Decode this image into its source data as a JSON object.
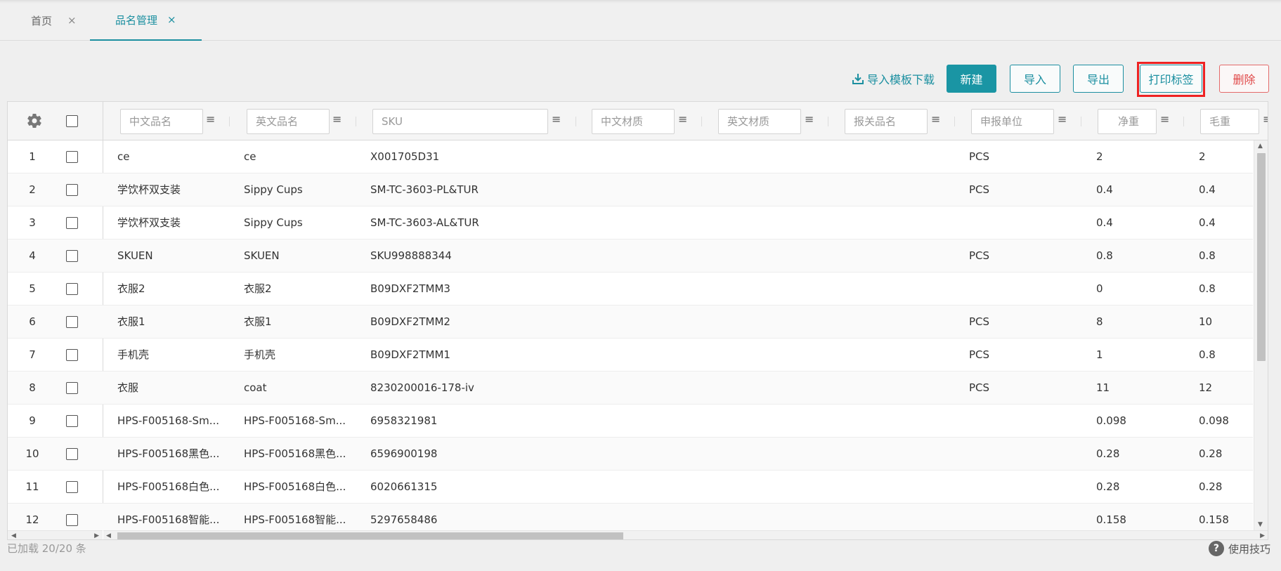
{
  "tabs": [
    {
      "label": "首页",
      "close": "×"
    },
    {
      "label": "品名管理",
      "close": "×"
    }
  ],
  "toolbar": {
    "template_download": "导入模板下载",
    "new": "新建",
    "import": "导入",
    "export": "导出",
    "print_label": "打印标签",
    "delete": "删除"
  },
  "filters": {
    "cn_name": "中文品名",
    "en_name": "英文品名",
    "sku": "SKU",
    "cn_material": "中文材质",
    "en_material": "英文材质",
    "customs_name": "报关品名",
    "unit": "申报单位",
    "net_weight": "净重",
    "gross_weight": "毛重"
  },
  "rows": [
    {
      "idx": "1",
      "cn": "ce",
      "en": "ce",
      "sku": "X001705D31",
      "unit": "PCS",
      "net": "2",
      "gross": "2"
    },
    {
      "idx": "2",
      "cn": "学饮杯双支装",
      "en": "Sippy Cups",
      "sku": "SM-TC-3603-PL&TUR",
      "unit": "PCS",
      "net": "0.4",
      "gross": "0.4"
    },
    {
      "idx": "3",
      "cn": "学饮杯双支装",
      "en": "Sippy Cups",
      "sku": "SM-TC-3603-AL&TUR",
      "unit": "",
      "net": "0.4",
      "gross": "0.4"
    },
    {
      "idx": "4",
      "cn": "SKUEN",
      "en": "SKUEN",
      "sku": "SKU998888344",
      "unit": "PCS",
      "net": "0.8",
      "gross": "0.8"
    },
    {
      "idx": "5",
      "cn": "衣服2",
      "en": "衣服2",
      "sku": "B09DXF2TMM3",
      "unit": "",
      "net": "0",
      "gross": "0.8"
    },
    {
      "idx": "6",
      "cn": "衣服1",
      "en": "衣服1",
      "sku": "B09DXF2TMM2",
      "unit": "PCS",
      "net": "8",
      "gross": "10"
    },
    {
      "idx": "7",
      "cn": "手机壳",
      "en": "手机壳",
      "sku": "B09DXF2TMM1",
      "unit": "PCS",
      "net": "1",
      "gross": "0.8"
    },
    {
      "idx": "8",
      "cn": "衣服",
      "en": "coat",
      "sku": "8230200016-178-iv",
      "unit": "PCS",
      "net": "11",
      "gross": "12"
    },
    {
      "idx": "9",
      "cn": "HPS-F005168-Sm...",
      "en": "HPS-F005168-Sm...",
      "sku": "6958321981",
      "unit": "",
      "net": "0.098",
      "gross": "0.098"
    },
    {
      "idx": "10",
      "cn": "HPS-F005168黑色...",
      "en": "HPS-F005168黑色...",
      "sku": "6596900198",
      "unit": "",
      "net": "0.28",
      "gross": "0.28"
    },
    {
      "idx": "11",
      "cn": "HPS-F005168白色...",
      "en": "HPS-F005168白色...",
      "sku": "6020661315",
      "unit": "",
      "net": "0.28",
      "gross": "0.28"
    },
    {
      "idx": "12",
      "cn": "HPS-F005168智能...",
      "en": "HPS-F005168智能...",
      "sku": "5297658486",
      "unit": "",
      "net": "0.158",
      "gross": "0.158"
    }
  ],
  "footer": {
    "status": "已加载 20/20 条",
    "tips": "使用技巧",
    "tips_icon": "?"
  },
  "icons": {
    "settings": "gear-icon",
    "download": "download-icon",
    "menu": "≡",
    "up": "▲",
    "down": "▼",
    "left": "◀",
    "right": "▶"
  },
  "colors": {
    "accent": "#1b8fa0",
    "primary_button": "#1a95a4",
    "danger": "#e04848",
    "highlight": "#ee2222"
  }
}
